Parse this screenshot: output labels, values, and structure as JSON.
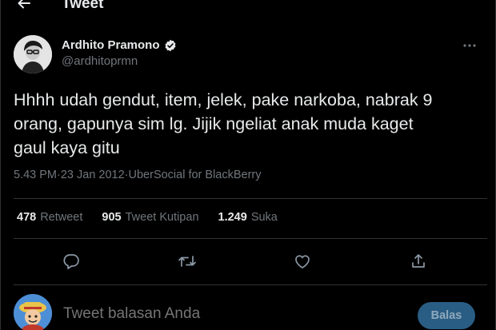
{
  "header": {
    "back_icon": "arrow-left-icon",
    "title": "Tweet"
  },
  "author": {
    "display_name": "Ardhito Pramono",
    "handle": "@ardhitoprmn",
    "verified_icon": "verified-badge-icon",
    "more_icon": "more-horizontal-icon"
  },
  "tweet": {
    "text": "Hhhh udah gendut, item, jelek, pake narkoba, nabrak 9\norang, gapunya sim lg. Jijik ngeliat anak muda kaget\ngaul kaya gitu",
    "time": "5.43 PM",
    "separator": " · ",
    "date": "23 Jan 2012",
    "source": "UberSocial for BlackBerry"
  },
  "stats": {
    "retweets": "478",
    "retweets_label": "Retweet",
    "quotes": "905",
    "quotes_label": "Tweet Kutipan",
    "likes": "1.249",
    "likes_label": "Suka"
  },
  "actions": {
    "reply_icon": "reply-icon",
    "retweet_icon": "retweet-icon",
    "like_icon": "heart-icon",
    "share_icon": "share-icon"
  },
  "reply": {
    "placeholder": "Tweet balasan Anda",
    "button_label": "Balas"
  },
  "colors": {
    "background": "#000000",
    "text_primary": "#e7e9ea",
    "text_secondary": "#71767b",
    "divider": "#2f3336",
    "reply_button_bg": "#2a5d84"
  }
}
